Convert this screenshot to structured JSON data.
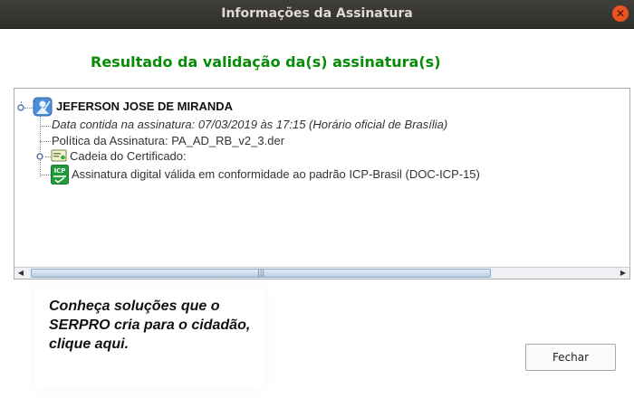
{
  "window": {
    "title": "Informações da Assinatura",
    "close_symbol": "✕"
  },
  "heading": "Resultado da validação da(s) assinatura(s)",
  "tree": {
    "signer": "JEFERSON JOSE DE MIRANDA",
    "date": "Data contida na assinatura: 07/03/2019 às 17:15 (Horário oficial de Brasília)",
    "policy": "Política da Assinatura: PA_AD_RB_v2_3.der",
    "chain": "Cadeia do Certificado:",
    "result": "Assinatura digital válida em conformidade ao padrão ICP-Brasil (DOC-ICP-15)",
    "icp_icon_label": "ICP"
  },
  "scrollbar": {
    "left_arrow": "◀",
    "right_arrow": "▶",
    "grip": "|||"
  },
  "promo": {
    "text": "Conheça  soluções que o SERPRO cria para o cidadão, clique aqui."
  },
  "buttons": {
    "close": "Fechar"
  },
  "colors": {
    "heading": "#068c06",
    "titlebar": "#3a3935",
    "close_button": "#e95420"
  }
}
